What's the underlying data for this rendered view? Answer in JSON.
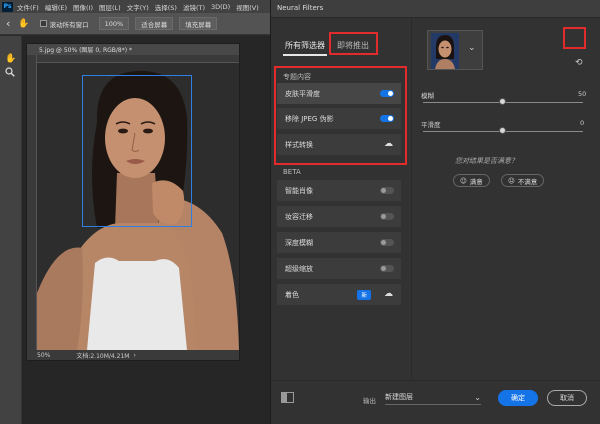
{
  "app": {
    "logo": "Ps"
  },
  "menu": [
    "文件(F)",
    "编辑(E)",
    "图像(I)",
    "图层(L)",
    "文字(Y)",
    "选择(S)",
    "滤镜(T)",
    "3D(D)",
    "视图(V)"
  ],
  "options_bar": {
    "scroll_all": "滚动所有窗口",
    "zoom_100": "100%",
    "fit_screen": "适合屏幕",
    "fill_screen": "填充屏幕"
  },
  "document": {
    "tab_title": "5.jpg @ 50% (图层 0, RGB/8*) *",
    "zoom": "50%",
    "doc_info": "文档:2.10M/4.21M"
  },
  "neural_filters": {
    "title": "Neural Filters",
    "tab_all": "所有筛选器",
    "tab_coming": "即将推出",
    "featured_label": "专题内容",
    "featured": [
      {
        "label": "皮肤平滑度",
        "control": "toggle",
        "on": true
      },
      {
        "label": "移除 JPEG 伪影",
        "control": "toggle",
        "on": true
      },
      {
        "label": "样式转换",
        "control": "cloud-download-icon"
      }
    ],
    "beta_label": "BETA",
    "beta": [
      {
        "label": "智能肖像",
        "control": "toggle",
        "on": false
      },
      {
        "label": "妆容迁移",
        "control": "toggle",
        "on": false
      },
      {
        "label": "深度模糊",
        "control": "toggle",
        "on": false
      },
      {
        "label": "超级缩放",
        "control": "toggle",
        "on": false
      },
      {
        "label": "着色",
        "control": "cloud-download-icon",
        "badge": "新"
      }
    ],
    "settings": {
      "blur_label": "模糊",
      "blur_value": "50",
      "smooth_label": "平滑度",
      "smooth_value": "0",
      "feedback_question": "您对结果是否满意？",
      "satisfied": "满意",
      "unsatisfied": "不满意"
    },
    "footer": {
      "output_label": "输出",
      "output_value": "新建图层",
      "ok": "确定",
      "cancel": "取消"
    }
  },
  "colors": {
    "accent": "#1473e6",
    "highlight": "#e42b2b"
  }
}
